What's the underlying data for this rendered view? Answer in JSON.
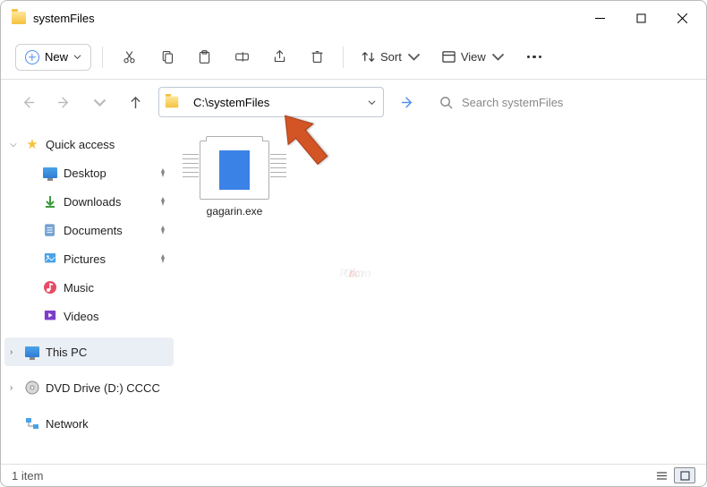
{
  "window": {
    "title": "systemFiles"
  },
  "toolbar": {
    "new_label": "New",
    "sort_label": "Sort",
    "view_label": "View"
  },
  "nav": {
    "address": "C:\\systemFiles",
    "search_placeholder": "Search systemFiles"
  },
  "sidebar": {
    "quick_access": "Quick access",
    "items": [
      {
        "label": "Desktop",
        "icon": "desktop",
        "pinned": true
      },
      {
        "label": "Downloads",
        "icon": "download",
        "pinned": true
      },
      {
        "label": "Documents",
        "icon": "document",
        "pinned": true
      },
      {
        "label": "Pictures",
        "icon": "picture",
        "pinned": true
      },
      {
        "label": "Music",
        "icon": "music",
        "pinned": false
      },
      {
        "label": "Videos",
        "icon": "video",
        "pinned": false
      }
    ],
    "this_pc": "This PC",
    "dvd": "DVD Drive (D:) CCCC",
    "network": "Network"
  },
  "content": {
    "files": [
      {
        "name": "gagarin.exe",
        "icon": "exe-doc"
      }
    ]
  },
  "statusbar": {
    "count_text": "1 item"
  },
  "watermark": {
    "t1": "PC",
    "t2": "risk",
    "t3": ".com"
  }
}
